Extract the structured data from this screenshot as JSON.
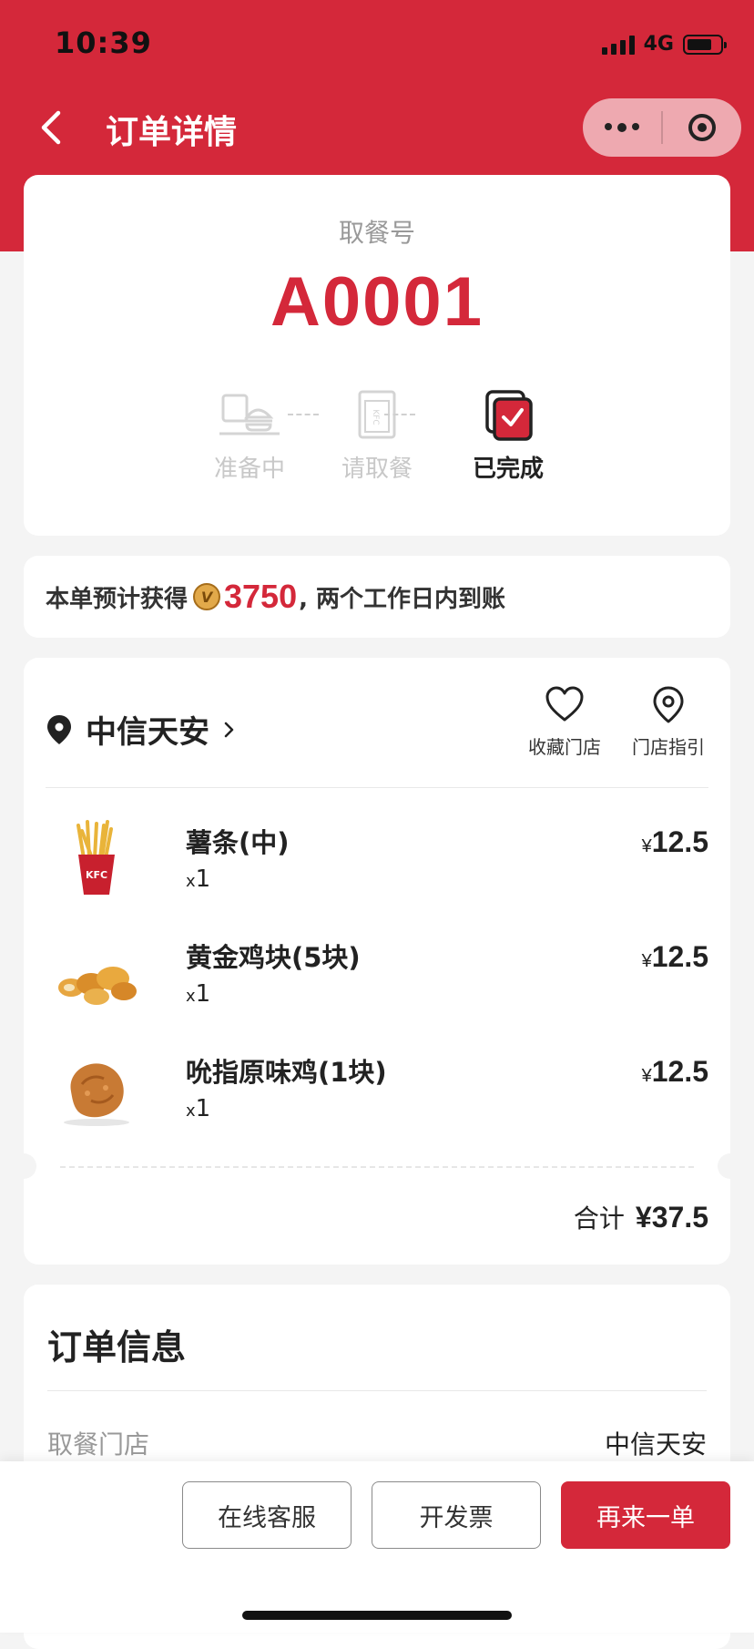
{
  "status_bar": {
    "time": "10:39",
    "network": "4G"
  },
  "nav": {
    "title": "订单详情",
    "back_icon": "chevron-left-icon",
    "more_icon": "more-dots-icon",
    "close_icon": "target-icon"
  },
  "pickup": {
    "label": "取餐号",
    "number": "A0001",
    "steps": [
      {
        "label": "准备中",
        "icon": "burger-tray-icon",
        "active": false
      },
      {
        "label": "请取餐",
        "icon": "kfc-bag-icon",
        "active": false
      },
      {
        "label": "已完成",
        "icon": "completed-check-icon",
        "active": true
      }
    ]
  },
  "points": {
    "prefix": "本单预计获得",
    "coin_symbol": "V",
    "amount": "3750",
    "suffix": ", 两个工作日内到账"
  },
  "order": {
    "store_name": "中信天安",
    "favorite_label": "收藏门店",
    "guide_label": "门店指引",
    "currency": "¥",
    "items": [
      {
        "name": "薯条(中)",
        "qty_prefix": "x",
        "qty": "1",
        "price": "12.5",
        "icon": "fries-icon"
      },
      {
        "name": "黄金鸡块(5块)",
        "qty_prefix": "x",
        "qty": "1",
        "price": "12.5",
        "icon": "nuggets-icon"
      },
      {
        "name": "吮指原味鸡(1块)",
        "qty_prefix": "x",
        "qty": "1",
        "price": "12.5",
        "icon": "fried-chicken-icon"
      }
    ],
    "total_label": "合计",
    "total_amount": "¥37.5"
  },
  "info": {
    "title": "订单信息",
    "rows": [
      {
        "label": "取餐门店",
        "value": "中信天安"
      }
    ]
  },
  "actions": {
    "service_label": "在线客服",
    "invoice_label": "开发票",
    "reorder_label": "再来一单"
  },
  "colors": {
    "brand_red": "#d4283a",
    "background": "#f4f4f4"
  }
}
